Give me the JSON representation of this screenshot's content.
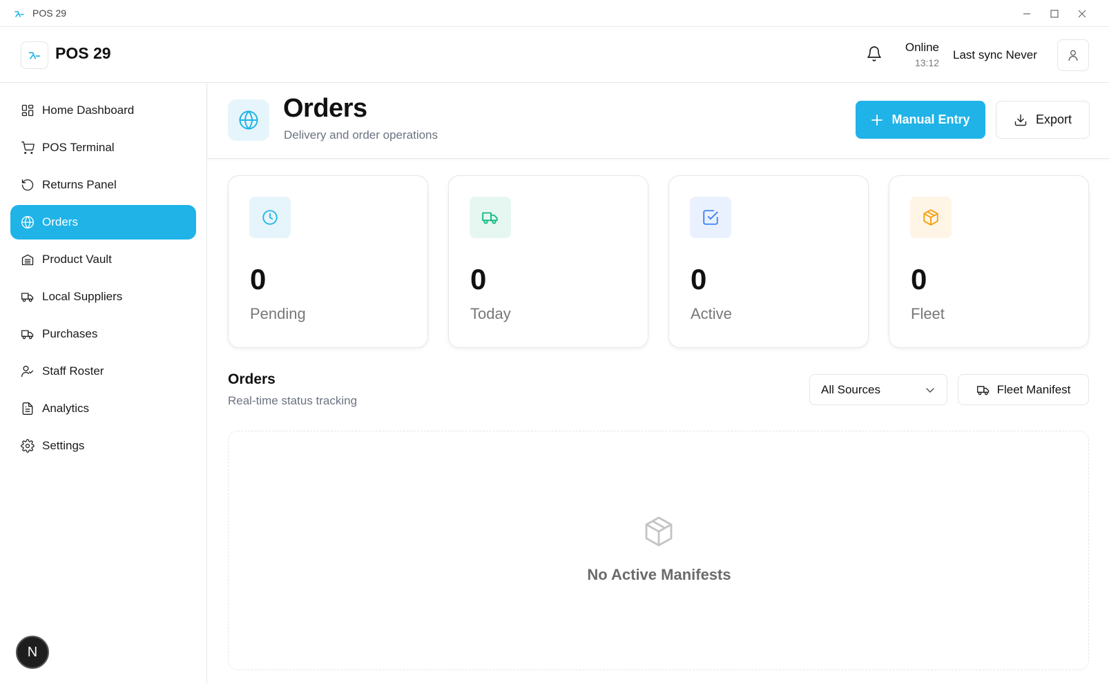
{
  "window": {
    "title": "POS 29"
  },
  "header": {
    "brand": "POS 29",
    "status": "Online",
    "time": "13:12",
    "sync": "Last sync Never"
  },
  "sidebar": {
    "items": [
      {
        "label": "Home Dashboard",
        "icon": "dashboard-icon"
      },
      {
        "label": "POS Terminal",
        "icon": "cart-icon"
      },
      {
        "label": "Returns Panel",
        "icon": "rotate-ccw-icon"
      },
      {
        "label": "Orders",
        "icon": "globe-icon",
        "active": true
      },
      {
        "label": "Product Vault",
        "icon": "vault-icon"
      },
      {
        "label": "Local Suppliers",
        "icon": "truck-icon"
      },
      {
        "label": "Purchases",
        "icon": "truck-icon"
      },
      {
        "label": "Staff Roster",
        "icon": "user-check-icon"
      },
      {
        "label": "Analytics",
        "icon": "file-text-icon"
      },
      {
        "label": "Settings",
        "icon": "gear-icon"
      }
    ],
    "avatar_letter": "N"
  },
  "page": {
    "title": "Orders",
    "subtitle": "Delivery and order operations",
    "primary_button": "Manual Entry",
    "export_button": "Export"
  },
  "stats": [
    {
      "value": "0",
      "label": "Pending",
      "icon": "clock-icon",
      "color": "#1fb3e8"
    },
    {
      "value": "0",
      "label": "Today",
      "icon": "truck-icon",
      "color": "#10b981"
    },
    {
      "value": "0",
      "label": "Active",
      "icon": "check-square-icon",
      "color": "#3b82f6"
    },
    {
      "value": "0",
      "label": "Fleet",
      "icon": "package-icon",
      "color": "#f59e0b"
    }
  ],
  "orders": {
    "title": "Orders",
    "subtitle": "Real-time status tracking",
    "filter": "All Sources",
    "fleet_button": "Fleet Manifest",
    "empty_text": "No Active Manifests"
  },
  "colors": {
    "accent": "#1fb3e8"
  }
}
